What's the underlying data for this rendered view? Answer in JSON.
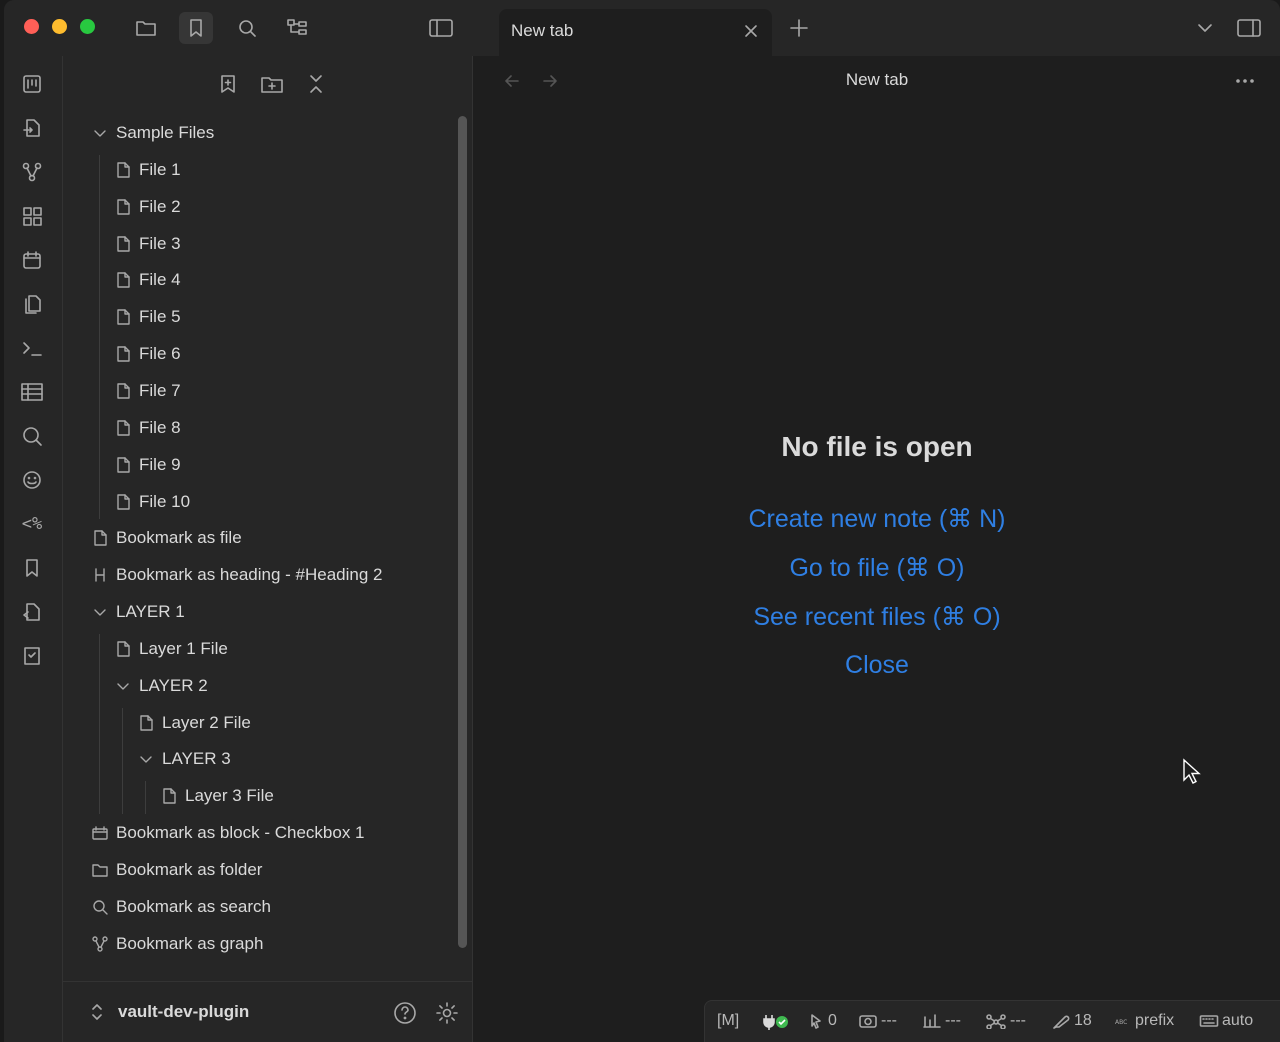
{
  "tab": {
    "title": "New tab"
  },
  "view": {
    "title": "New tab"
  },
  "empty_state": {
    "title": "No file is open",
    "actions": [
      "Create new note (⌘ N)",
      "Go to file (⌘ O)",
      "See recent files (⌘ O)",
      "Close"
    ]
  },
  "sidebar": {
    "tree": [
      {
        "label": "Sample Files",
        "icon": "chevron-down-icon",
        "depth": 0
      },
      {
        "label": "File 1",
        "icon": "file-icon",
        "depth": 1
      },
      {
        "label": "File 2",
        "icon": "file-icon",
        "depth": 1
      },
      {
        "label": "File 3",
        "icon": "file-icon",
        "depth": 1
      },
      {
        "label": "File 4",
        "icon": "file-icon",
        "depth": 1
      },
      {
        "label": "File 5",
        "icon": "file-icon",
        "depth": 1
      },
      {
        "label": "File 6",
        "icon": "file-icon",
        "depth": 1
      },
      {
        "label": "File 7",
        "icon": "file-icon",
        "depth": 1
      },
      {
        "label": "File 8",
        "icon": "file-icon",
        "depth": 1
      },
      {
        "label": "File 9",
        "icon": "file-icon",
        "depth": 1
      },
      {
        "label": "File 10",
        "icon": "file-icon",
        "depth": 1
      },
      {
        "label": "Bookmark as file",
        "icon": "file-icon",
        "depth": 0
      },
      {
        "label": "Bookmark as heading - #Heading 2",
        "icon": "heading-icon",
        "depth": 0
      },
      {
        "label": "LAYER 1",
        "icon": "chevron-down-icon",
        "depth": 0
      },
      {
        "label": "Layer 1 File",
        "icon": "file-icon",
        "depth": 1
      },
      {
        "label": "LAYER 2",
        "icon": "chevron-down-icon",
        "depth": 1
      },
      {
        "label": "Layer 2 File",
        "icon": "file-icon",
        "depth": 2
      },
      {
        "label": "LAYER 3",
        "icon": "chevron-down-icon",
        "depth": 2
      },
      {
        "label": "Layer 3 File",
        "icon": "file-icon",
        "depth": 3
      },
      {
        "label": "Bookmark as block - Checkbox 1",
        "icon": "block-icon",
        "depth": 0
      },
      {
        "label": "Bookmark as folder",
        "icon": "folder-icon",
        "depth": 0
      },
      {
        "label": "Bookmark as search",
        "icon": "search-icon",
        "depth": 0
      },
      {
        "label": "Bookmark as graph",
        "icon": "graph-icon",
        "depth": 0
      }
    ],
    "vault_name": "vault-dev-plugin"
  },
  "ribbon_text": {
    "templater": "<%"
  },
  "status_bar": {
    "mode": "[M]",
    "linter_count": "0",
    "item_a": "---",
    "item_b": "---",
    "item_c": "---",
    "count": "18",
    "prefix": "prefix",
    "auto": "auto"
  },
  "colors": {
    "accent_link": "#2f7fe3",
    "traffic_red": "#ff5f57",
    "traffic_yellow": "#febc2e",
    "traffic_green": "#28c840",
    "status_ok": "#3fb950"
  }
}
